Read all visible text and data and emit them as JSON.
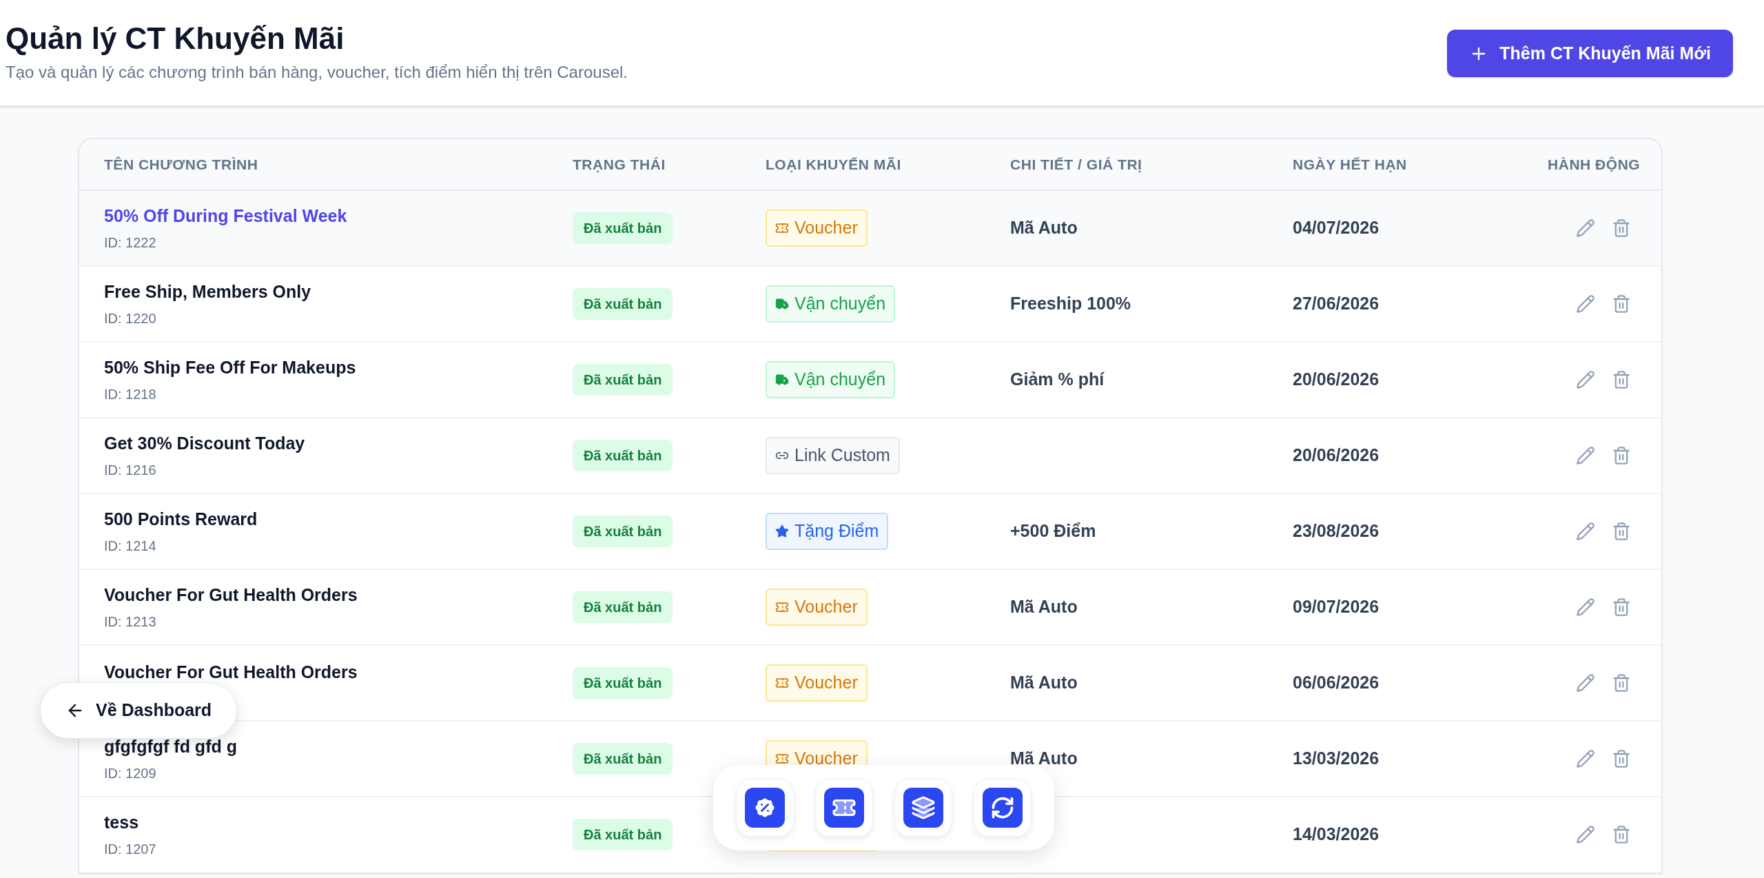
{
  "header": {
    "title": "Quản lý CT Khuyến Mãi",
    "subtitle": "Tạo và quản lý các chương trình bán hàng, voucher, tích điểm hiển thị trên Carousel.",
    "add_button": "Thêm CT Khuyến Mãi Mới"
  },
  "table": {
    "columns": [
      "TÊN CHƯƠNG TRÌNH",
      "TRẠNG THÁI",
      "LOẠI KHUYẾN MÃI",
      "CHI TIẾT / GIÁ TRỊ",
      "NGÀY HẾT HẠN",
      "HÀNH ĐỘNG"
    ],
    "rows": [
      {
        "name": "50% Off During Festival Week",
        "id": "ID: 1222",
        "status": "Đã xuất bản",
        "type": {
          "kind": "voucher",
          "label": "Voucher"
        },
        "detail": "Mã Auto",
        "expiry": "04/07/2026",
        "highlighted": true
      },
      {
        "name": "Free Ship, Members Only",
        "id": "ID: 1220",
        "status": "Đã xuất bản",
        "type": {
          "kind": "shipping",
          "label": "Vận chuyển"
        },
        "detail": "Freeship 100%",
        "expiry": "27/06/2026",
        "highlighted": false
      },
      {
        "name": "50% Ship Fee Off For Makeups",
        "id": "ID: 1218",
        "status": "Đã xuất bản",
        "type": {
          "kind": "shipping",
          "label": "Vận chuyển"
        },
        "detail": "Giảm % phí",
        "expiry": "20/06/2026",
        "highlighted": false
      },
      {
        "name": "Get 30% Discount Today",
        "id": "ID: 1216",
        "status": "Đã xuất bản",
        "type": {
          "kind": "link",
          "label": "Link Custom"
        },
        "expiry": "20/06/2026",
        "highlighted": false
      },
      {
        "name": "500 Points Reward",
        "id": "ID: 1214",
        "status": "Đã xuất bản",
        "type": {
          "kind": "points",
          "label": "Tặng Điểm"
        },
        "detail": "+500 Điểm",
        "expiry": "23/08/2026",
        "highlighted": false
      },
      {
        "name": "Voucher For Gut Health Orders",
        "id": "ID: 1213",
        "status": "Đã xuất bản",
        "type": {
          "kind": "voucher",
          "label": "Voucher"
        },
        "detail": "Mã Auto",
        "expiry": "09/07/2026",
        "highlighted": false
      },
      {
        "name": "Voucher For Gut Health Orders",
        "status": "Đã xuất bản",
        "type": {
          "kind": "voucher",
          "label": "Voucher"
        },
        "detail": "Mã Auto",
        "expiry": "06/06/2026",
        "highlighted": false
      },
      {
        "name": "gfgfgfgf fd gfd g",
        "id": "ID: 1209",
        "status": "Đã xuất bản",
        "type": {
          "kind": "voucher",
          "label": "Voucher"
        },
        "detail": "Mã Auto",
        "expiry": "13/03/2026",
        "highlighted": false
      },
      {
        "name": "tess",
        "id": "ID: 1207",
        "status": "Đã xuất bản",
        "type": {
          "kind": "voucher"
        },
        "expiry": "14/03/2026",
        "highlighted": false
      }
    ]
  },
  "back_button": "Về Dashboard"
}
